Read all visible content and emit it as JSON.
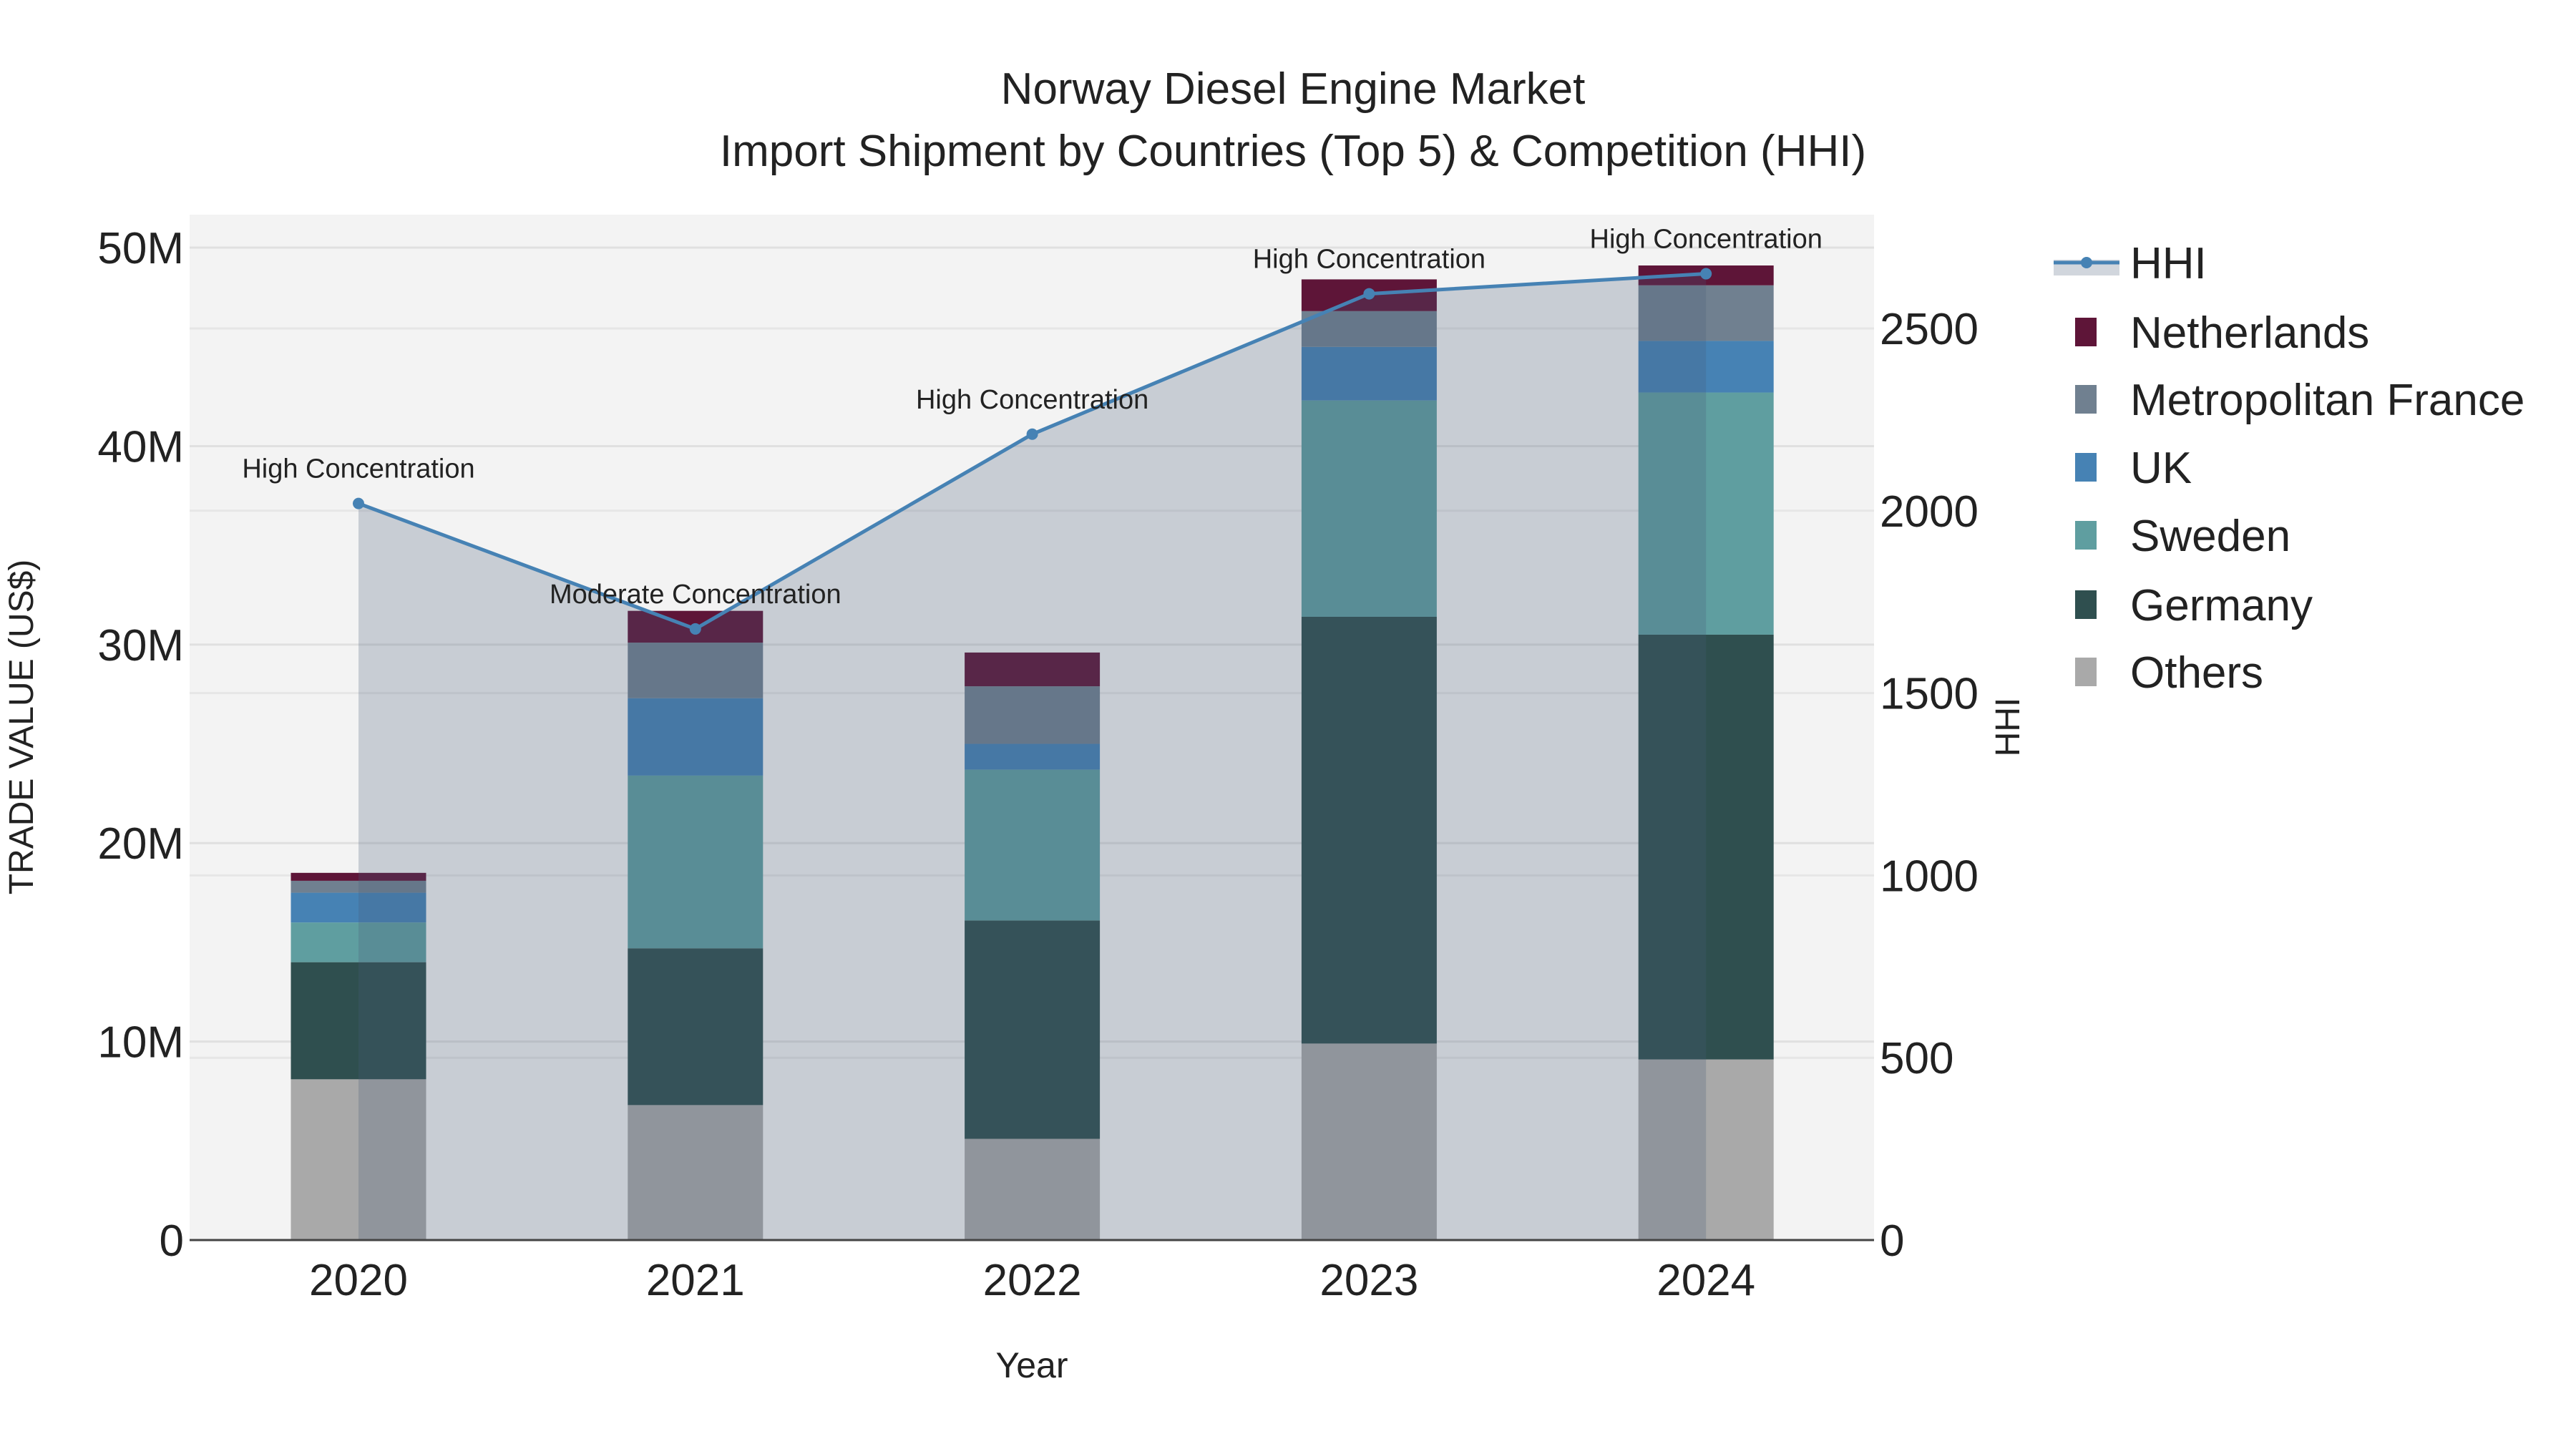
{
  "chart_data": {
    "type": "bar",
    "title": "Norway Diesel Engine Market",
    "subtitle": "Import Shipment by Countries (Top 5) & Competition (HHI)",
    "xlabel": "Year",
    "ylabel": "TRADE VALUE (US$)",
    "y2label": "HHI",
    "categories": [
      "2020",
      "2021",
      "2022",
      "2023",
      "2024"
    ],
    "ylim": [
      0,
      51.66
    ],
    "y2lim": [
      0,
      2812
    ],
    "yticks": [
      {
        "v": 0,
        "label": "0"
      },
      {
        "v": 10,
        "label": "10M"
      },
      {
        "v": 20,
        "label": "20M"
      },
      {
        "v": 30,
        "label": "30M"
      },
      {
        "v": 40,
        "label": "40M"
      },
      {
        "v": 50,
        "label": "50M"
      }
    ],
    "y2ticks": [
      {
        "v": 0,
        "label": "0"
      },
      {
        "v": 500,
        "label": "500"
      },
      {
        "v": 1000,
        "label": "1000"
      },
      {
        "v": 1500,
        "label": "1500"
      },
      {
        "v": 2000,
        "label": "2000"
      },
      {
        "v": 2500,
        "label": "2500"
      }
    ],
    "value_unit": "million US$",
    "stacked": true,
    "series": [
      {
        "name": "Others",
        "color": "#a9a9a9",
        "values": [
          8.1,
          6.8,
          5.1,
          9.9,
          9.1
        ]
      },
      {
        "name": "Germany",
        "color": "#2f4f4f",
        "values": [
          5.9,
          7.9,
          11.0,
          21.5,
          21.4
        ]
      },
      {
        "name": "Sweden",
        "color": "#5f9ea0",
        "values": [
          2.0,
          8.7,
          7.6,
          10.9,
          12.2
        ]
      },
      {
        "name": "UK",
        "color": "#4682b4",
        "values": [
          1.5,
          3.9,
          1.3,
          2.7,
          2.6
        ]
      },
      {
        "name": "Metropolitan France",
        "color": "#708090",
        "values": [
          0.6,
          2.8,
          2.9,
          1.8,
          2.8
        ]
      },
      {
        "name": "Netherlands",
        "color": "#5e1538",
        "values": [
          0.4,
          1.6,
          1.7,
          1.6,
          1.0
        ]
      }
    ],
    "line": {
      "name": "HHI",
      "color": "#4682b4",
      "axis": "right",
      "values": [
        2020,
        1676,
        2210,
        2595,
        2650
      ]
    },
    "annotations": [
      "High Concentration",
      "Moderate Concentration",
      "High Concentration",
      "High Concentration",
      "High Concentration"
    ],
    "legend_order": [
      "HHI",
      "Netherlands",
      "Metropolitan France",
      "UK",
      "Sweden",
      "Germany",
      "Others"
    ],
    "legend_placement": "right",
    "grid": true
  }
}
